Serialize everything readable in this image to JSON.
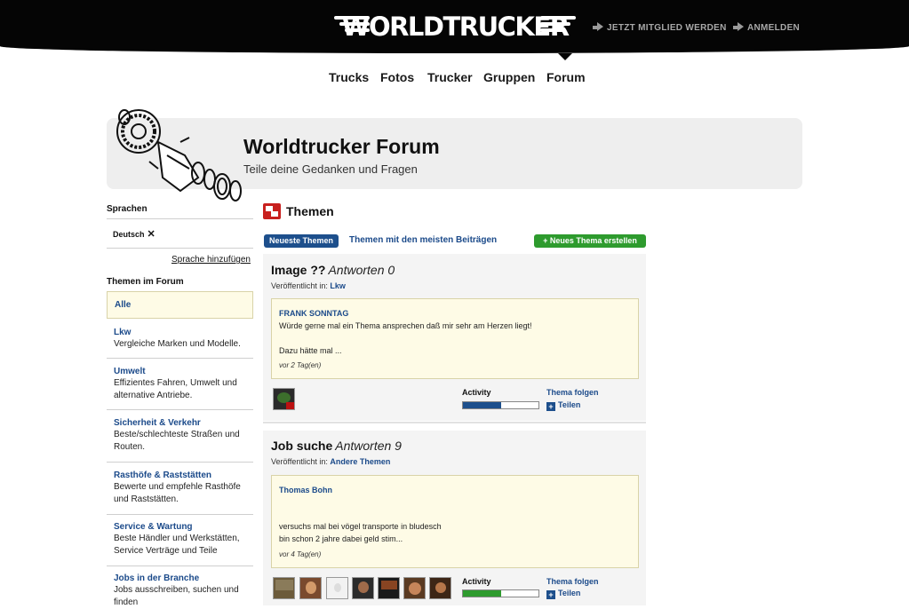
{
  "header": {
    "logo_text": "WORLDTRUCKER",
    "join_label": "JETZT MITGLIED WERDEN",
    "login_label": "ANMELDEN"
  },
  "nav": {
    "items": [
      "Trucks",
      "Fotos",
      "Trucker",
      "Gruppen",
      "Forum"
    ]
  },
  "banner": {
    "title": "Worldtrucker Forum",
    "subtitle": "Teile deine Gedanken und Fragen"
  },
  "sidebar": {
    "languages_heading": "Sprachen",
    "language_chip": "Deutsch",
    "language_remove": "✕",
    "add_language": "Sprache hinzufügen",
    "topics_heading": "Themen im Forum",
    "all_label": "Alle",
    "categories": [
      {
        "title": "Lkw",
        "desc": "Vergleiche Marken und Modelle."
      },
      {
        "title": "Umwelt",
        "desc": "Effizientes Fahren, Umwelt und alternative Antriebe."
      },
      {
        "title": "Sicherheit & Verkehr",
        "desc": "Beste/schlechteste Straßen und Routen."
      },
      {
        "title": "Rasthöfe & Raststätten",
        "desc": "Bewerte und empfehle Rasthöfe und Raststätten."
      },
      {
        "title": "Service & Wartung",
        "desc": "Beste Händler und Werkstätten, Service Verträge und Teile"
      },
      {
        "title": "Jobs in der Branche",
        "desc": "Jobs ausschreiben, suchen und finden"
      }
    ]
  },
  "content": {
    "section_title": "Themen",
    "tab_active": "Neueste Themen",
    "tab_other": "Themen mit den meisten Beiträgen",
    "new_topic": "+ Neues Thema erstellen",
    "topics": [
      {
        "title": "Image ??",
        "answers": "Antworten 0",
        "published_prefix": "Veröffentlicht in:",
        "category": "Lkw",
        "author": "FRANK SONNTAG",
        "text_line1": "Würde gerne mal ein Thema ansprechen daß mir sehr am Herzen liegt!",
        "text_line2": "Dazu hätte mal ...",
        "when": "vor 2 Tag(en)",
        "activity_label": "Activity",
        "activity_level": 0.5,
        "activity_color": "#1d4f8c",
        "follow": "Thema folgen",
        "share": "Teilen"
      },
      {
        "title": "Job suche",
        "answers": "Antworten 9",
        "published_prefix": "Veröffentlicht in:",
        "category": "Andere Themen",
        "author": "Thomas Bohn",
        "text_line1": "versuchs mal bei vögel transporte in bludesch",
        "text_line2": "bin schon 2 jahre dabei geld stim...",
        "when": "vor 4 Tag(en)",
        "activity_label": "Activity",
        "activity_level": 0.5,
        "activity_color": "#2e9b2e",
        "follow": "Thema folgen",
        "share": "Teilen"
      }
    ]
  }
}
